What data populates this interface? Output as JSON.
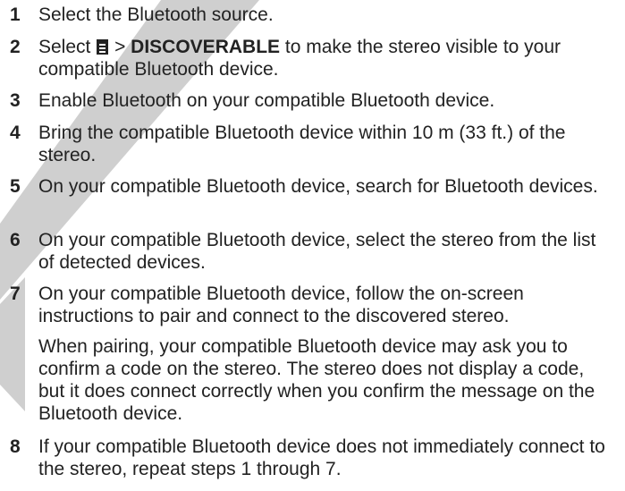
{
  "steps": [
    {
      "number": "1",
      "text": "Select the Bluetooth source."
    },
    {
      "number": "2",
      "pre": "Select",
      "icon": "menu-icon",
      "sep": ">",
      "bold": "DISCOVERABLE",
      "post": "to make the stereo visible to your compatible Bluetooth device."
    },
    {
      "number": "3",
      "text": "Enable Bluetooth on your compatible Bluetooth device."
    },
    {
      "number": "4",
      "text": "Bring the compatible Bluetooth device within 10 m (33 ft.) of the stereo."
    },
    {
      "number": "5",
      "text": "On your compatible Bluetooth device, search for Bluetooth devices."
    },
    {
      "number": "6",
      "text": "On your compatible Bluetooth device, select the stereo from the list of detected devices."
    },
    {
      "number": "7",
      "text": "On your compatible Bluetooth device, follow the on-screen instructions to pair and connect to the discovered stereo.",
      "note": "When pairing, your compatible Bluetooth device may ask you to confirm a code on the stereo. The stereo does not display a code, but it does connect correctly when you confirm the message on the Bluetooth device."
    },
    {
      "number": "8",
      "text": "If your compatible Bluetooth device does not immediately connect to the stereo, repeat steps 1 through 7."
    }
  ],
  "colors": {
    "text": "#222222",
    "watermark": "#cfcfcf"
  }
}
